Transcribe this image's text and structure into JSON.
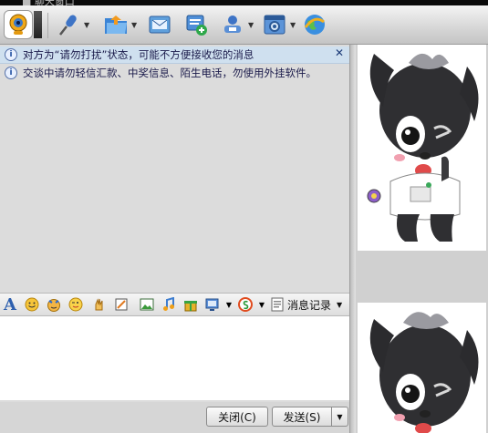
{
  "window": {
    "title": "■ 聊天窗口"
  },
  "toolbar": {
    "items": [
      {
        "name": "video-call",
        "icon": "webcam-icon"
      },
      {
        "name": "voice-call",
        "icon": "microphone-icon"
      },
      {
        "name": "send-file",
        "icon": "folder-icon"
      },
      {
        "name": "send-mail",
        "icon": "mail-icon"
      },
      {
        "name": "create-group",
        "icon": "add-note-icon"
      },
      {
        "name": "remote-assist",
        "icon": "user-monitor-icon"
      },
      {
        "name": "app-settings",
        "icon": "gear-window-icon"
      },
      {
        "name": "browser",
        "icon": "globe-icon"
      }
    ]
  },
  "notices": {
    "busy": "对方为“请勿打扰”状态，可能不方便接收您的消息",
    "warning": "交谈中请勿轻信汇款、中奖信息、陌生电话，勿使用外挂软件。"
  },
  "format_bar": {
    "font_glyph": "A",
    "history_label": "消息记录"
  },
  "buttons": {
    "close": "关闭(C)",
    "send": "发送(S)"
  },
  "colors": {
    "accent": "#1e4ea0",
    "notice_bg": "#cfe0ef"
  }
}
